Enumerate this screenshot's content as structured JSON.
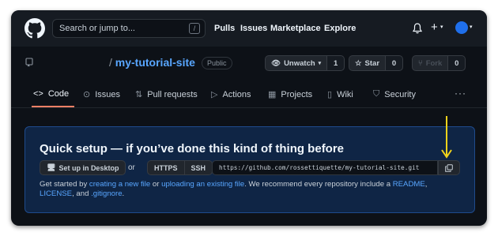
{
  "header": {
    "search_placeholder": "Search or jump to...",
    "search_shortcut": "/",
    "nav": [
      "Pulls",
      "Issues",
      "Marketplace",
      "Explore"
    ]
  },
  "repo": {
    "separator": "/",
    "name": "my-tutorial-site",
    "visibility": "Public",
    "unwatch_label": "Unwatch",
    "unwatch_count": "1",
    "star_label": "Star",
    "star_count": "0",
    "fork_label": "Fork",
    "fork_count": "0"
  },
  "tabs": [
    {
      "label": "Code",
      "icon": "code-icon",
      "active": true
    },
    {
      "label": "Issues",
      "icon": "issue-icon"
    },
    {
      "label": "Pull requests",
      "icon": "pull-request-icon"
    },
    {
      "label": "Actions",
      "icon": "play-icon"
    },
    {
      "label": "Projects",
      "icon": "table-icon"
    },
    {
      "label": "Wiki",
      "icon": "book-icon"
    },
    {
      "label": "Security",
      "icon": "shield-icon"
    }
  ],
  "setup": {
    "title": "Quick setup — if you’ve done this kind of thing before",
    "desktop_button": "Set up in Desktop",
    "or": "or",
    "protocols": [
      "HTTPS",
      "SSH"
    ],
    "clone_url": "https://github.com/rossettiquette/my-tutorial-site.git",
    "help": {
      "t1": "Get started by ",
      "link1": "creating a new file",
      "t2": " or ",
      "link2": "uploading an existing file",
      "t3": ". We recommend every repository include a ",
      "link3": "README",
      "t4": ",",
      "link4": "LICENSE",
      "t5": ", and ",
      "link5": ".gitignore",
      "t6": "."
    }
  },
  "colors": {
    "background": "#0d1117",
    "header": "#161b22",
    "link": "#58a6ff",
    "active_tab": "#f78166",
    "setup_bg": "#0f2545",
    "annotation_arrow": "#f2d31b"
  }
}
